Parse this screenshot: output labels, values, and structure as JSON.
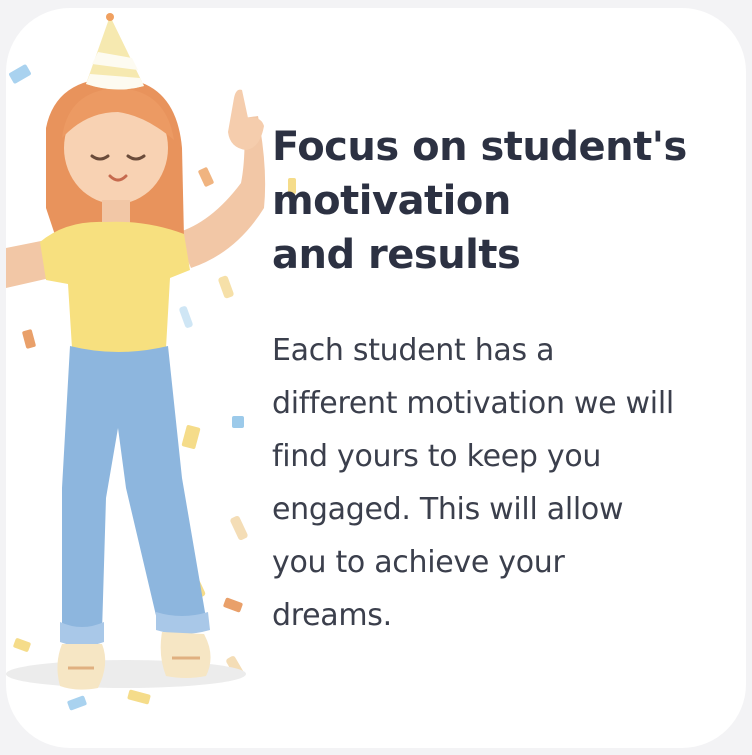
{
  "card": {
    "title_lines": [
      "Focus on student's",
      "motivation",
      "and results"
    ],
    "body": "Each student has a different motivation we will find yours to keep you engaged. This will allow you to achieve your dreams."
  },
  "colors": {
    "background": "#f3f3f5",
    "card": "#ffffff",
    "title": "#2c3142",
    "body": "#3b3f4c",
    "hair": "#e8935c",
    "shirt": "#f7e07f",
    "pants": "#8db6de",
    "hat": "#f6e9b0"
  },
  "illustration": {
    "icon": "celebrating-girl-illustration"
  }
}
